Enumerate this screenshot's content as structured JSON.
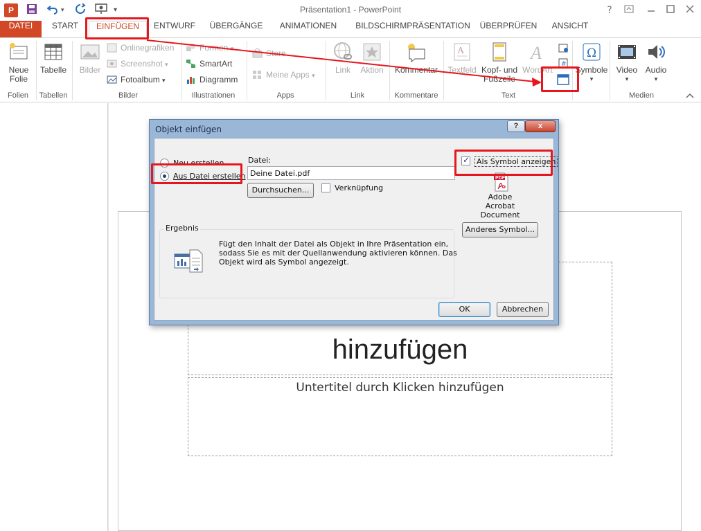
{
  "window": {
    "title": "Präsentation1 - PowerPoint",
    "app_icon": "P",
    "help": "?"
  },
  "tabs": [
    {
      "label": "DATEI"
    },
    {
      "label": "START"
    },
    {
      "label": "EINFÜGEN"
    },
    {
      "label": "ENTWURF"
    },
    {
      "label": "ÜBERGÄNGE"
    },
    {
      "label": "ANIMATIONEN"
    },
    {
      "label": "BILDSCHIRMPRÄSENTATION"
    },
    {
      "label": "ÜBERPRÜFEN"
    },
    {
      "label": "ANSICHT"
    }
  ],
  "ribbon": {
    "groups": {
      "folien": "Folien",
      "tabellen": "Tabellen",
      "bilder": "Bilder",
      "illustrationen": "Illustrationen",
      "apps": "Apps",
      "link": "Link",
      "kommentare": "Kommentare",
      "text": "Text",
      "medien": "Medien"
    },
    "buttons": {
      "neue_folie_1": "Neue",
      "neue_folie_2": "Folie",
      "tabelle": "Tabelle",
      "bilder": "Bilder",
      "onlinegrafiken": "Onlinegrafiken",
      "screenshot": "Screenshot",
      "fotoalbum": "Fotoalbum",
      "formen": "Formen",
      "smartart": "SmartArt",
      "diagramm": "Diagramm",
      "store": "Store",
      "meine_apps": "Meine Apps",
      "link": "Link",
      "aktion": "Aktion",
      "kommentar": "Kommentar",
      "textfeld": "Textfeld",
      "kopf_1": "Kopf- und",
      "kopf_2": "Fußzeile",
      "wordart": "WordArt",
      "symbole": "Symbole",
      "video": "Video",
      "audio": "Audio"
    }
  },
  "slide": {
    "title_placeholder": "hinzufügen",
    "subtitle_placeholder": "Untertitel durch Klicken hinzufügen"
  },
  "dialog": {
    "title": "Objekt einfügen",
    "help_label": "?",
    "close_label": "x",
    "option_new": "Neu erstellen",
    "option_from_file": "Aus Datei erstellen",
    "file_label": "Datei:",
    "file_value": "Deine Datei.pdf",
    "browse_button": "Durchsuchen...",
    "link_checkbox": "Verknüpfung",
    "show_as_icon": "Als Symbol anzeigen",
    "symbol_caption_1": "Adobe",
    "symbol_caption_2": "Acrobat",
    "symbol_caption_3": "Document",
    "change_icon_button": "Anderes Symbol...",
    "result_label": "Ergebnis",
    "result_line_1": "Fügt den Inhalt der Datei als Objekt in Ihre Präsentation ein,",
    "result_line_2": "sodass Sie es mit der Quellanwendung aktivieren können. Das",
    "result_line_3": "Objekt wird als Symbol angezeigt.",
    "ok_button": "OK",
    "cancel_button": "Abbrechen",
    "pdf_badge": "PDF",
    "show_as_icon_checked": true,
    "selected_option": "Aus Datei erstellen"
  },
  "colors": {
    "accent": "#d24726",
    "annotation": "#e5161d",
    "dialog_frame": "#9bb7d8"
  }
}
